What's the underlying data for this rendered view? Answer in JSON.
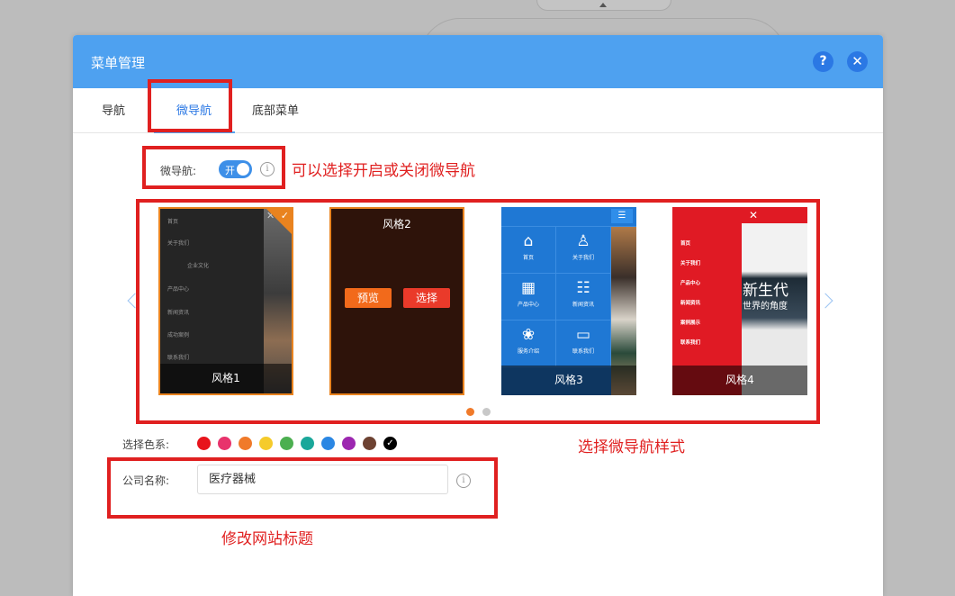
{
  "modal": {
    "title": "菜单管理",
    "help_icon": "?",
    "close_icon": "✕"
  },
  "tabs": [
    "导航",
    "微导航",
    "底部菜单"
  ],
  "micro_nav": {
    "label": "微导航:",
    "toggle_text": "开",
    "toggle_on": true,
    "info_icon": "i"
  },
  "styles": [
    {
      "name": "风格1",
      "selected": true
    },
    {
      "name": "风格2",
      "hover": true,
      "preview_label": "预览",
      "select_label": "选择"
    },
    {
      "name": "风格3"
    },
    {
      "name": "风格4"
    }
  ],
  "carousel": {
    "pages": 2,
    "active_page": 1
  },
  "style1_menu": [
    "首页",
    "关于我们",
    "企业文化",
    "产品中心",
    "新闻资讯",
    "成功案例",
    "联系我们"
  ],
  "style3_grid": [
    {
      "icon": "⌂",
      "label": "首页"
    },
    {
      "icon": "♙",
      "label": "关于我们"
    },
    {
      "icon": "▦",
      "label": "产品中心"
    },
    {
      "icon": "☷",
      "label": "新闻资讯"
    },
    {
      "icon": "❀",
      "label": "服务介绍"
    },
    {
      "icon": "▭",
      "label": "联系我们"
    }
  ],
  "style4_menu": [
    "首页",
    "关于我们",
    "产品中心",
    "新闻资讯",
    "案例展示",
    "联系我们"
  ],
  "style4_headline": "新生代",
  "style4_subline": "世界的角度",
  "color_scheme": {
    "label": "选择色系:",
    "colors": [
      "#e8141c",
      "#e8336c",
      "#f07a2a",
      "#f5cb2b",
      "#4caf50",
      "#1aa79a",
      "#2b87e3",
      "#9c27b0",
      "#6d4232",
      "#000000"
    ],
    "selected_index": 9
  },
  "company": {
    "label": "公司名称:",
    "value": "医疗器械",
    "info_icon": "i"
  },
  "annotations": {
    "toggle_note": "可以选择开启或关闭微导航",
    "style_note": "选择微导航样式",
    "title_note": "修改网站标题",
    "color": "#e02020"
  }
}
